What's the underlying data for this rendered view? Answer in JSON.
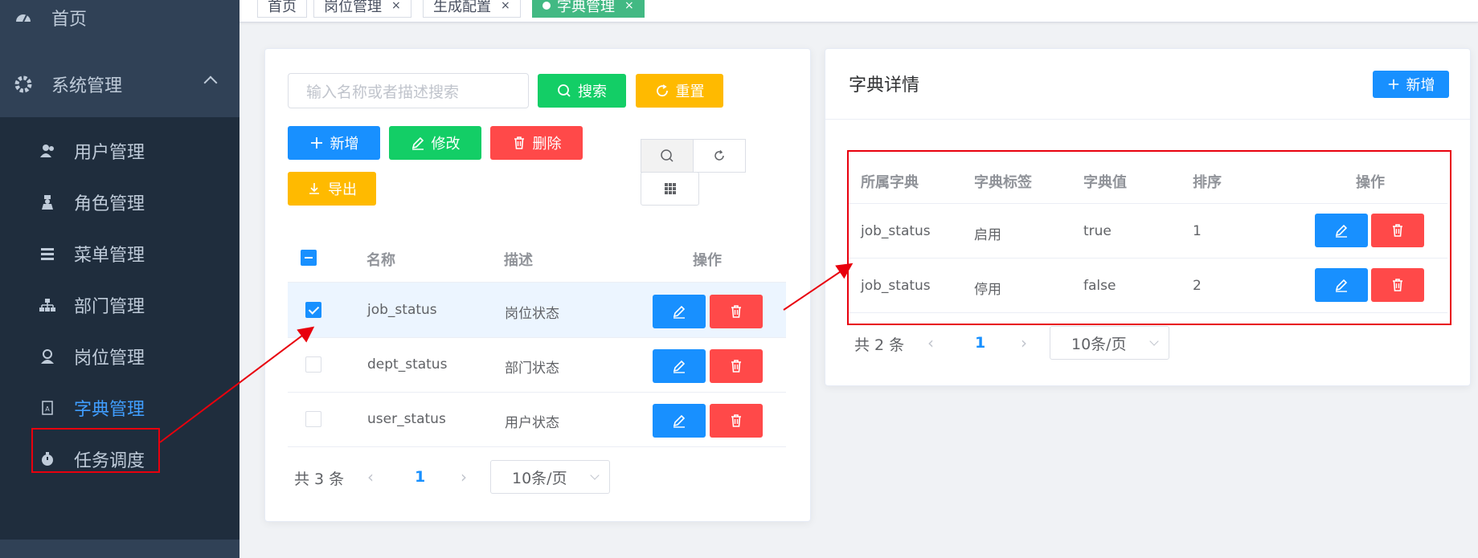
{
  "sidebar": {
    "home": "首页",
    "system": "系统管理",
    "items": [
      {
        "label": "用户管理"
      },
      {
        "label": "角色管理"
      },
      {
        "label": "菜单管理"
      },
      {
        "label": "部门管理"
      },
      {
        "label": "岗位管理"
      },
      {
        "label": "字典管理"
      },
      {
        "label": "任务调度"
      }
    ]
  },
  "tags": [
    "首页",
    "岗位管理",
    "生成配置",
    "字典管理"
  ],
  "tag_close": "×",
  "left": {
    "search_placeholder": "输入名称或者描述搜索",
    "search_btn": "搜索",
    "reset_btn": "重置",
    "add_btn": "新增",
    "edit_btn": "修改",
    "delete_btn": "删除",
    "export_btn": "导出",
    "columns": [
      "名称",
      "描述",
      "操作"
    ],
    "rows": [
      {
        "name": "job_status",
        "desc": "岗位状态"
      },
      {
        "name": "dept_status",
        "desc": "部门状态"
      },
      {
        "name": "user_status",
        "desc": "用户状态"
      }
    ],
    "total": "共 3 条",
    "page": "1",
    "page_size": "10条/页"
  },
  "right": {
    "title": "字典详情",
    "add_btn": "新增",
    "columns": [
      "所属字典",
      "字典标签",
      "字典值",
      "排序",
      "操作"
    ],
    "rows": [
      {
        "dict": "job_status",
        "label": "启用",
        "value": "true",
        "sort": "1"
      },
      {
        "dict": "job_status",
        "label": "停用",
        "value": "false",
        "sort": "2"
      }
    ],
    "total": "共 2 条",
    "page": "1",
    "page_size": "10条/页"
  },
  "colors": {
    "sidebar_bg": "#304156",
    "accent": "#1890ff",
    "success": "#13ce66",
    "warning": "#ffba00",
    "danger": "#ff4949",
    "annotation": "#e8000d"
  }
}
